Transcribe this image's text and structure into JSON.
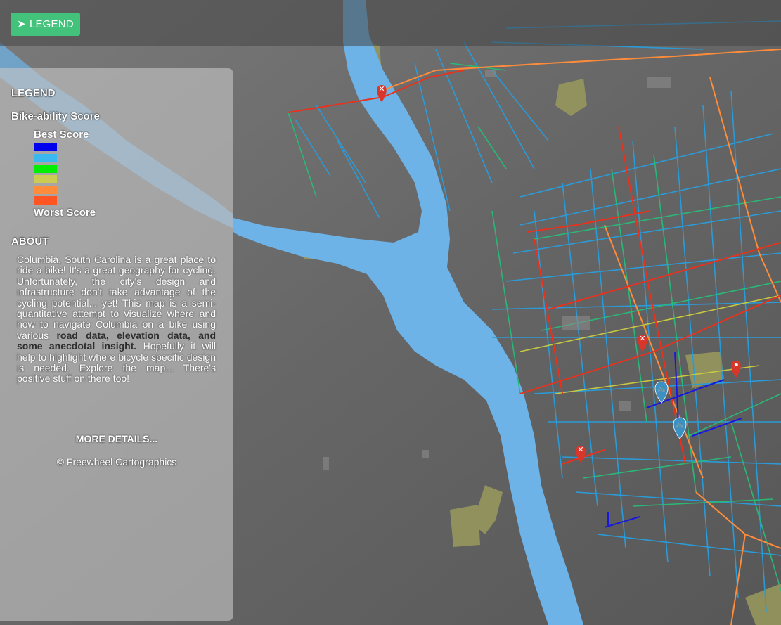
{
  "map": {
    "markers": [
      {
        "type": "hazard",
        "color": "#d9362b",
        "icon": "x-icon"
      },
      {
        "type": "hazard",
        "color": "#d9362b",
        "icon": "x-icon"
      },
      {
        "type": "hazard",
        "color": "#d9362b",
        "icon": "x-icon"
      },
      {
        "type": "flag",
        "color": "#d9362b",
        "icon": "flag-icon"
      },
      {
        "type": "bike",
        "color": "#3b91c4",
        "icon": "bicycle-icon"
      },
      {
        "type": "bike",
        "color": "#3b91c4",
        "icon": "bicycle-icon"
      }
    ],
    "colors": {
      "river": "#6db3e8",
      "terrain": "#6a6a6a",
      "park": "#9a9a5e"
    }
  },
  "toolbar": {
    "legend_button": "LEGEND",
    "arrow": "➤"
  },
  "legend": {
    "title": "LEGEND",
    "score_title": "Bike-ability Score",
    "best_label": "Best Score",
    "worst_label": "Worst Score",
    "swatches": [
      "#0000ee",
      "#39b9ef",
      "#00ee00",
      "#cccc55",
      "#ff8c3a",
      "#ff5522"
    ]
  },
  "about": {
    "title": "ABOUT",
    "text_1": "Columbia, South Carolina is a great place to ride a bike! It's a great geography for cycling. Unfortunately, the city's design and infrastructure don't take advantage of the cycling potential... yet! This map is a semi-quantitative attempt to visualize where and how to navigate Columbia on a bike using various ",
    "bold": "road data, elevation data, and some anecdotal insight.",
    "text_2": " Hopefully it will help to highlight where bicycle specific design is needed. Explore the map... There's positive stuff on there too!",
    "more_link": "MORE DETAILS...",
    "credit": "© Freewheel Cartographics"
  }
}
